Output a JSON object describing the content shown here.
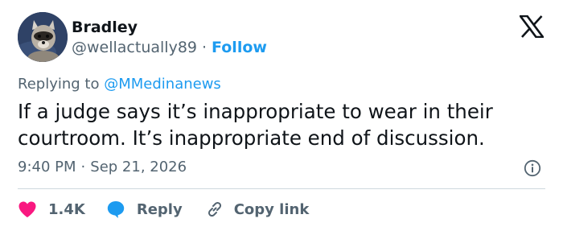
{
  "author": {
    "name": "Bradley",
    "handle": "@wellactually89",
    "separator": "·",
    "follow_label": "Follow"
  },
  "reply_context": {
    "prefix": "Replying to",
    "mention": "@MMedinanews"
  },
  "tweet": {
    "text": "If a judge says it’s inappropriate to wear in their courtroom. It’s inappropriate end of discussion."
  },
  "meta": {
    "time": "9:40 PM",
    "separator": "·",
    "date": "Sep 21, 2026"
  },
  "actions": {
    "like_count": "1.4K",
    "reply_label": "Reply",
    "copy_link_label": "Copy link"
  },
  "icons": {
    "brand": "x-logo-icon",
    "info": "info-icon",
    "like": "heart-icon",
    "reply": "speech-bubble-icon",
    "copy_link": "link-icon"
  },
  "colors": {
    "accent": "#1d9bf0",
    "like": "#f91880",
    "text": "#0f1419",
    "secondary": "#536471",
    "divider": "#cfd9de"
  }
}
